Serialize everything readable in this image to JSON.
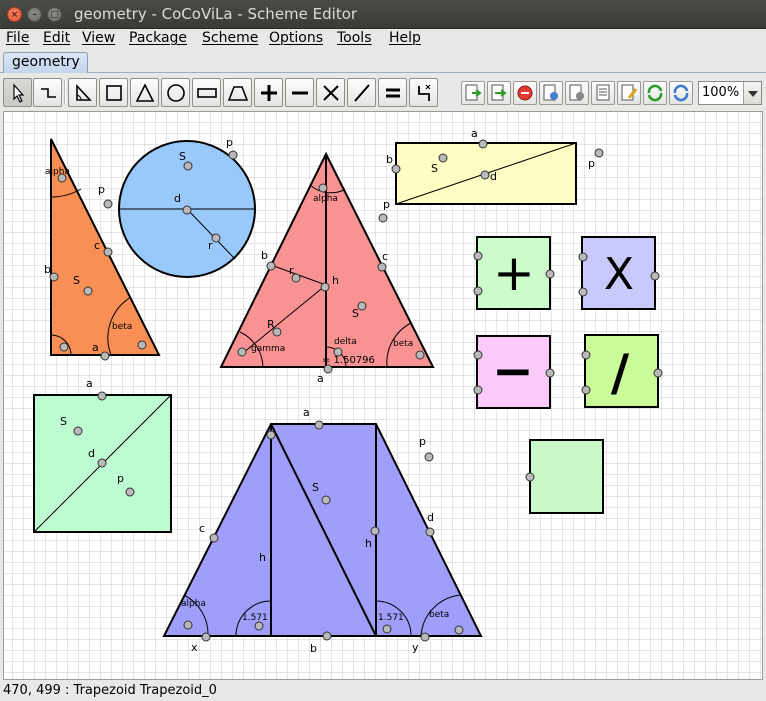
{
  "window": {
    "title": "geometry - CoCoViLa - Scheme Editor"
  },
  "menu": {
    "items": [
      "File",
      "Edit",
      "View",
      "Package",
      "Scheme",
      "Options",
      "Tools",
      "Help"
    ]
  },
  "tabs": [
    {
      "label": "geometry",
      "selected": true
    }
  ],
  "toolbar": {
    "tools": [
      "select-arrow-icon",
      "relation-tool-icon",
      "right-triangle-icon",
      "square-icon",
      "triangle-icon",
      "circle-icon",
      "rectangle-icon",
      "trapezoid-icon",
      "plus-icon",
      "minus-icon",
      "multiply-icon",
      "divide-icon",
      "equals-icon",
      "subscheme-port-icon"
    ],
    "actions": [
      "specification-icon",
      "compute-icon",
      "stop-icon",
      "run-icon",
      "edit-spec-icon",
      "options-icon",
      "edit-class-icon",
      "reload-icon",
      "refresh-icon"
    ],
    "zoom": "100%"
  },
  "canvas": {
    "right_triangle": {
      "labels": [
        "alpha",
        "p",
        "c",
        "b",
        "S",
        "beta",
        "a"
      ]
    },
    "circle": {
      "labels": [
        "S",
        "p",
        "d",
        "r"
      ]
    },
    "triangle": {
      "labels": [
        "alpha",
        "p",
        "b",
        "c",
        "r",
        "h",
        "S",
        "R",
        "delta",
        "gamma",
        "beta",
        "= 1.50796",
        "a"
      ]
    },
    "rectangle": {
      "labels": [
        "a",
        "b",
        "S",
        "d",
        "p"
      ]
    },
    "operators": {
      "plus": "+",
      "multiply": "X",
      "minus": "−",
      "divide": "/"
    },
    "square": {
      "labels": [
        "a",
        "S",
        "d",
        "p"
      ]
    },
    "trapezoid": {
      "labels": [
        "a",
        "p",
        "S",
        "c",
        "d",
        "h",
        "h",
        "alpha",
        "1.571",
        "1.571",
        "beta",
        "x",
        "b",
        "y"
      ]
    },
    "colors": {
      "right_triangle": "#f98f55",
      "circle": "#99c8fb",
      "triangle": "#f99292",
      "rectangle": "#fdfdc4",
      "plus": "#ccfcca",
      "multiply": "#c9c9fb",
      "minus": "#fbcafb",
      "divide": "#cafb98",
      "square": "#bdfcd0",
      "trapezoid": "#9f9ffb",
      "small_square": "#caf9c9"
    }
  },
  "status": {
    "text": "470, 499 : Trapezoid Trapezoid_0"
  }
}
